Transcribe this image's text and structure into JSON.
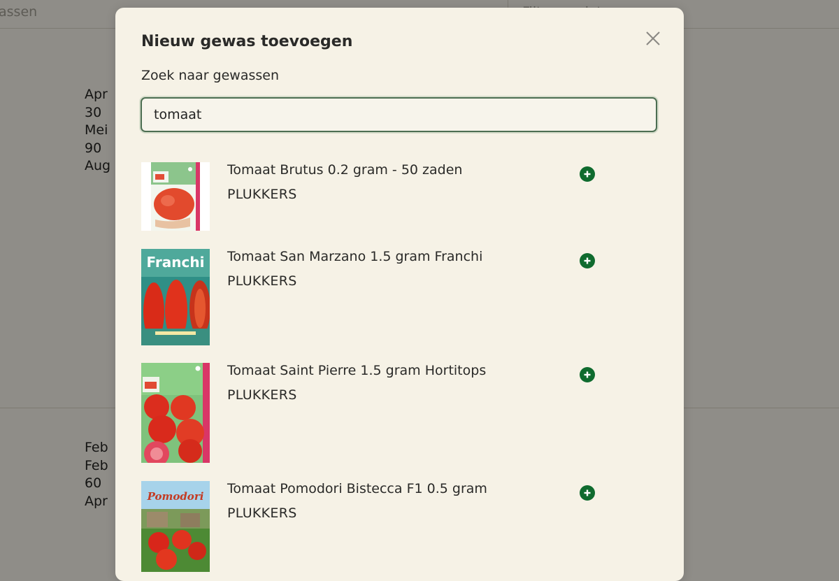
{
  "background": {
    "search_placeholder": "assen",
    "filter_text": "Filter op datum",
    "group1": [
      "Apr",
      "30",
      "Mei",
      "90",
      "Aug"
    ],
    "group2": [
      "Feb",
      "Feb",
      "60",
      "Apr"
    ]
  },
  "modal": {
    "title": "Nieuw gewas toevoegen",
    "search_label": "Zoek naar gewassen",
    "search_value": "tomaat",
    "close_icon": "close-icon",
    "accent_color": "#0f6b2e",
    "results": [
      {
        "name": "Tomaat Brutus 0.2 gram - 50 zaden",
        "brand": "PLUKKERS",
        "thumb": "seed-packet-brutus",
        "add_icon": "plus-circle-icon"
      },
      {
        "name": "Tomaat San Marzano 1.5 gram Franchi",
        "brand": "PLUKKERS",
        "thumb": "seed-packet-franchi",
        "thumb_text": "Franchi",
        "add_icon": "plus-circle-icon"
      },
      {
        "name": "Tomaat Saint Pierre 1.5 gram Hortitops",
        "brand": "PLUKKERS",
        "thumb": "seed-packet-saint-pierre",
        "add_icon": "plus-circle-icon"
      },
      {
        "name": "Tomaat Pomodori Bistecca F1 0.5 gram",
        "brand": "PLUKKERS",
        "thumb": "seed-packet-pomodori",
        "thumb_text": "Pomodori",
        "add_icon": "plus-circle-icon"
      }
    ]
  }
}
